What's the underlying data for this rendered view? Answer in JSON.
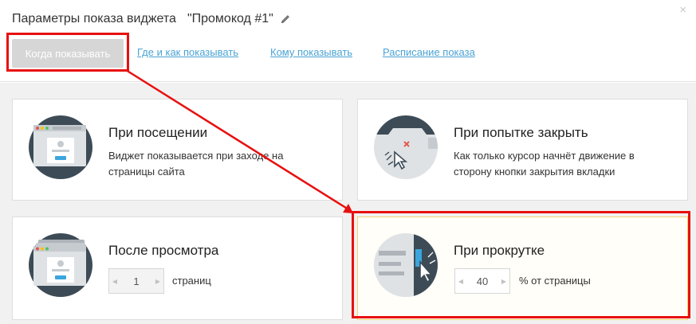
{
  "header": {
    "title": "Параметры показа виджета",
    "widget_name": "\"Промокод #1\"",
    "close_glyph": "×"
  },
  "tabs": [
    {
      "label": "Когда показывать",
      "active": true
    },
    {
      "label": "Где и как показывать",
      "active": false
    },
    {
      "label": "Кому показывать",
      "active": false
    },
    {
      "label": "Расписание показа",
      "active": false
    }
  ],
  "cards": {
    "visit": {
      "title": "При посещении",
      "description": "Виджет показывается при заходе на страницы сайта",
      "icon": "browser-window-icon"
    },
    "exit": {
      "title": "При попытке закрыть",
      "description": "Как только курсор начнёт движение в сторону кнопки закрытия вкладки",
      "icon": "close-tab-cursor-icon"
    },
    "views": {
      "title": "После просмотра",
      "stepper_value": "1",
      "stepper_suffix": "страниц",
      "icon": "stacked-pages-icon"
    },
    "scroll": {
      "title": "При прокрутке",
      "stepper_value": "40",
      "stepper_suffix": "% от страницы",
      "icon": "scroll-cursor-icon",
      "selected": true
    }
  },
  "colors": {
    "accent_link": "#4aa3d5",
    "annotation_red": "#e81010",
    "selected_border": "#f2d472",
    "icon_dark": "#3d4b56"
  }
}
